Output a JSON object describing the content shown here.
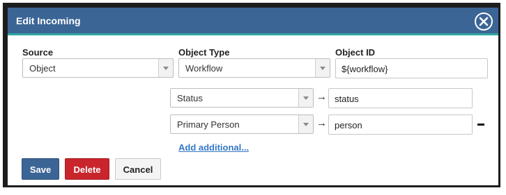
{
  "dialog": {
    "title": "Edit Incoming",
    "close_icon": "close-circle-icon"
  },
  "fields": {
    "source": {
      "label": "Source",
      "value": "Object"
    },
    "object_type": {
      "label": "Object Type",
      "value": "Workflow"
    },
    "object_id": {
      "label": "Object ID",
      "value": "${workflow}"
    }
  },
  "mappings": [
    {
      "field": "Status",
      "arrow": "→",
      "target": "status"
    },
    {
      "field": "Primary Person",
      "arrow": "→",
      "target": "person"
    }
  ],
  "add_additional_label": "Add additional...",
  "buttons": {
    "save": "Save",
    "delete": "Delete",
    "cancel": "Cancel"
  },
  "colors": {
    "header": "#3b6595",
    "header_accent": "#2ea9a0",
    "save": "#3b6595",
    "delete": "#c9252c",
    "link": "#3478c6"
  }
}
